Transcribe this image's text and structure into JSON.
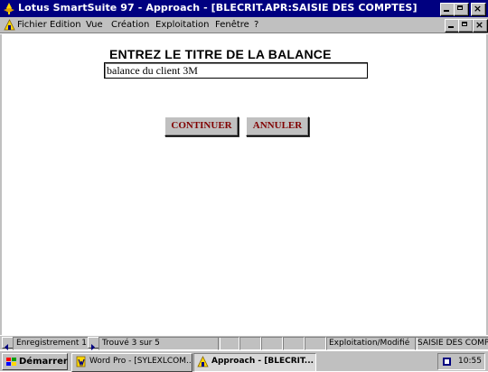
{
  "window": {
    "title": "Lotus SmartSuite 97   -  Approach - [BLECRIT.APR:SAISIE DES COMPTES]",
    "app_icon": "lotus-icon",
    "buttons": {
      "minimize": "_",
      "restore": "▣",
      "close": "×"
    }
  },
  "menubar": {
    "doc_icon": "approach-doc-icon",
    "items": [
      {
        "label": "Fichier"
      },
      {
        "label": "Edition"
      },
      {
        "label": "Vue"
      },
      {
        "label": "Création"
      },
      {
        "label": "Exploitation"
      },
      {
        "label": "Fenêtre"
      },
      {
        "label": "?"
      }
    ]
  },
  "form": {
    "heading": "ENTREZ LE TITRE DE LA BALANCE",
    "title_value": "balance du client 3M",
    "continue_label": "CONTINUER",
    "cancel_label": "ANNULER"
  },
  "statusbar": {
    "record": "Enregistrement 1",
    "found": "Trouvé 3 sur 5",
    "mode": "Exploitation/Modifié",
    "form_name": "SAISIE DES COMPTES"
  },
  "taskbar": {
    "start_label": "Démarrer",
    "tasks": [
      {
        "label": "Word Pro - [SYLEXLCOM...",
        "icon": "wordpro-icon"
      },
      {
        "label": "Approach - [BLECRIT...",
        "icon": "approach-icon"
      }
    ],
    "clock": "10:55"
  },
  "colors": {
    "titlebar": "#000080",
    "face": "#c0c0c0",
    "button_text": "#800000"
  }
}
